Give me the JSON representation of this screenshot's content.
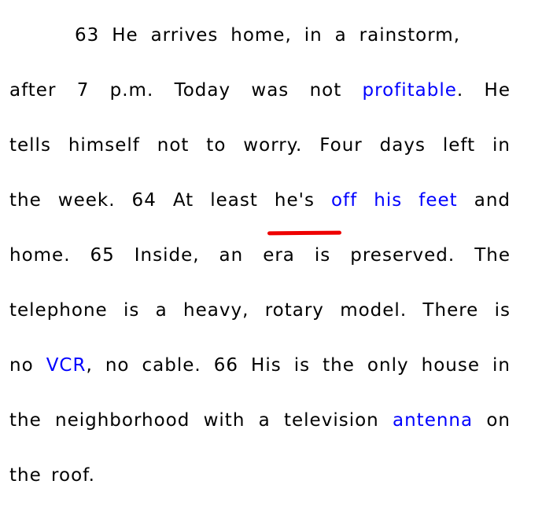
{
  "document": {
    "highlight_color": "#0000ff",
    "annotation_color": "#ee0000",
    "lines": [
      [
        {
          "t": "63 He arrives home, in a rainstorm,"
        }
      ],
      [
        {
          "t": "after 7 p.m. Today was not "
        },
        {
          "t": "profitable",
          "hl": true
        },
        {
          "t": ". He"
        }
      ],
      [
        {
          "t": "tells himself not to worry. Four days left in"
        }
      ],
      [
        {
          "t": "the week. 64 At least he's "
        },
        {
          "t": "off his feet",
          "hl": true
        },
        {
          "t": " and"
        }
      ],
      [
        {
          "t": "home. 65 Inside, an era is preserved. The"
        }
      ],
      [
        {
          "t": "telephone is a heavy, rotary model. There is"
        }
      ],
      [
        {
          "t": "no "
        },
        {
          "t": "VCR",
          "hl": true
        },
        {
          "t": ", no cable. 66 His is the only house in"
        }
      ],
      [
        {
          "t": "the neighborhood with a television "
        },
        {
          "t": "antenna",
          "hl": true
        },
        {
          "t": " on"
        }
      ],
      [
        {
          "t": "the roof."
        }
      ]
    ]
  }
}
